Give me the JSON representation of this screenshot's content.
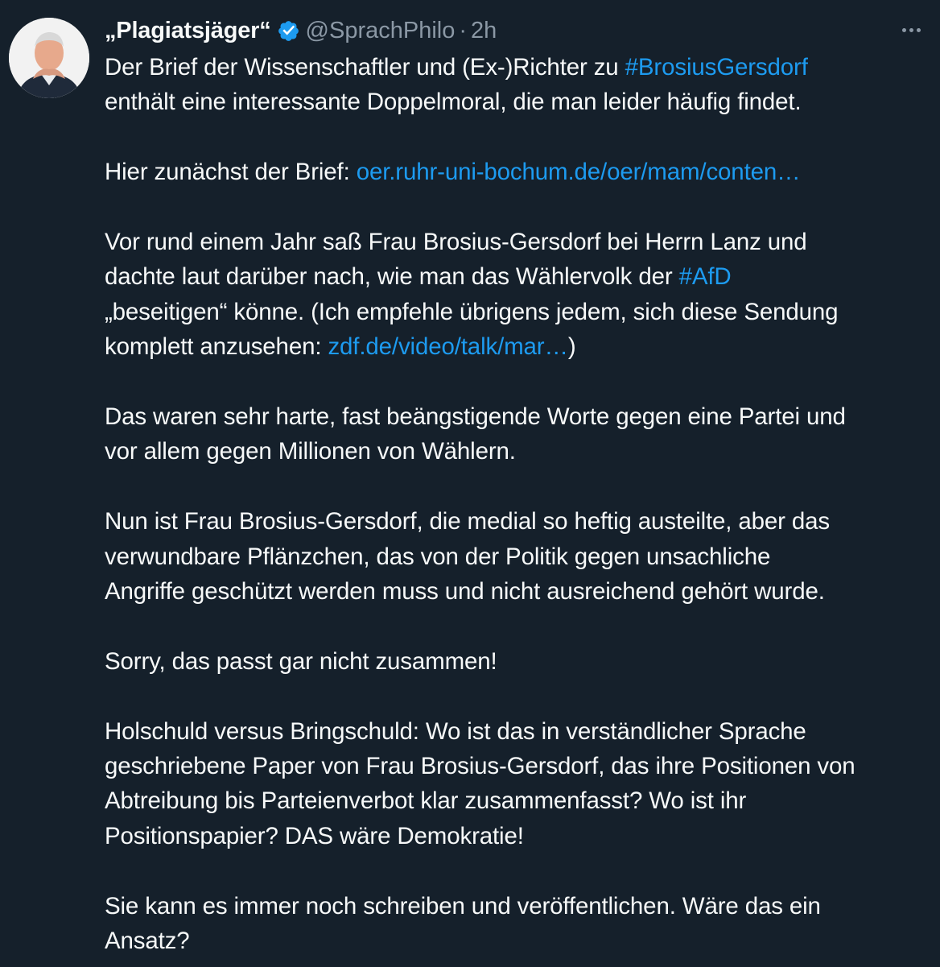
{
  "author": {
    "display_name": "„Plagiatsjäger“",
    "handle": "@SprachPhilo",
    "separator": "·",
    "time": "2h",
    "avatar_icon": "user-avatar",
    "verified_icon": "verified-badge-icon"
  },
  "menu": {
    "more_icon": "more-options-icon"
  },
  "tweet": {
    "p1": {
      "l1_text": "Der Brief der Wissenschaftler und (Ex-)Richter zu ",
      "l1_hashtag": "#BrosiusGersdorf",
      "l2_text": "enthält eine interessante Doppelmoral, die man leider häufig findet."
    },
    "p2": {
      "text": "Hier zunächst der Brief: ",
      "link": "oer.ruhr-uni-bochum.de/oer/mam/conten…"
    },
    "p3": {
      "l1_text": "Vor rund einem Jahr saß Frau Brosius-Gersdorf bei Herrn Lanz und",
      "l2_text": "dachte laut darüber nach, wie man das Wählervolk der ",
      "l2_hashtag": "#AfD",
      "l3_text": "„beseitigen“ könne. (Ich empfehle übrigens jedem, sich diese Sendung",
      "l4_text": "komplett anzusehen: ",
      "l4_link": "zdf.de/video/talk/mar…",
      "l4_close": ")"
    },
    "p4": {
      "l1_text": "Das waren sehr harte, fast beängstigende Worte gegen eine Partei und",
      "l2_text": "vor allem gegen Millionen von Wählern."
    },
    "p5": {
      "l1_text": "Nun ist Frau Brosius-Gersdorf, die medial so heftig austeilte, aber das",
      "l2_text": "verwundbare Pflänzchen, das von der Politik gegen unsachliche",
      "l3_text": "Angriffe geschützt werden muss und nicht ausreichend gehört wurde."
    },
    "p6": {
      "text": "Sorry, das passt gar nicht zusammen!"
    },
    "p7": {
      "l1_text": "Holschuld versus Bringschuld: Wo ist das in verständlicher Sprache",
      "l2_text": "geschriebene Paper von Frau Brosius-Gersdorf, das ihre Positionen von",
      "l3_text": "Abtreibung bis Parteienverbot klar zusammenfasst? Wo ist ihr",
      "l4_text": "Positionspapier? DAS wäre Demokratie!"
    },
    "p8": {
      "l1_text": "Sie kann es immer noch schreiben und veröffentlichen. Wäre das ein",
      "l2_text": "Ansatz?"
    }
  },
  "colors": {
    "background": "#15202b",
    "text": "#f7f9f9",
    "secondary": "#8b98a5",
    "link": "#1d9bf0"
  }
}
